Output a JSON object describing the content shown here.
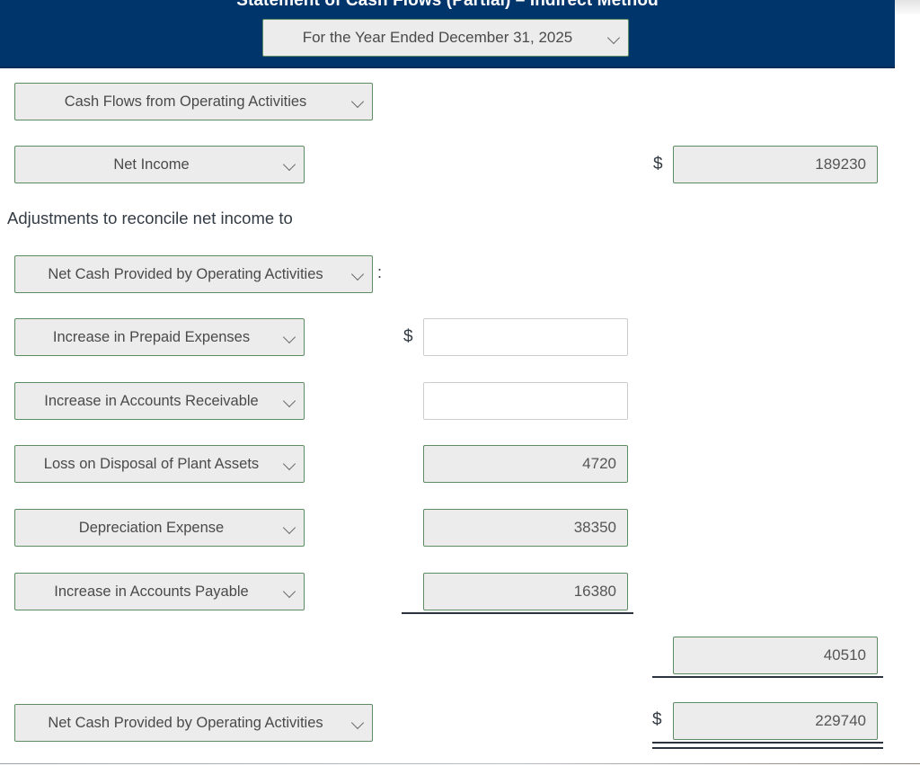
{
  "header": {
    "title": "Statement of Cash Flows (Partial) – Indirect Method",
    "period_select": {
      "value": "For the Year Ended December 31, 2025",
      "caret": "chevron-down-icon"
    },
    "background_color": "#00356b"
  },
  "colors": {
    "header_navy": "#00356b",
    "select_border_green": "#5e8c63",
    "select_fill_gray": "#ececec",
    "empty_input_border": "#cdcdcd",
    "rule_dark": "#2b3340",
    "text_dark": "#333b44"
  },
  "statement": {
    "section_select": {
      "value": "Cash Flows from Operating Activities"
    },
    "net_income_row": {
      "label_select": {
        "value": "Net Income"
      },
      "currency_symbol": "$",
      "amount": "189230"
    },
    "adjustments_text": "Adjustments to reconcile net income to",
    "subheading_select": {
      "value": "Net Cash Provided by Operating Activities"
    },
    "subheading_colon": ":",
    "first_adjustment_currency_symbol": "$",
    "adjustment_rows": [
      {
        "label_select": {
          "value": "Increase in Prepaid Expenses"
        },
        "amount": "",
        "filled": false
      },
      {
        "label_select": {
          "value": "Increase in Accounts Receivable"
        },
        "amount": "",
        "filled": false
      },
      {
        "label_select": {
          "value": "Loss on Disposal of Plant Assets"
        },
        "amount": "4720",
        "filled": true
      },
      {
        "label_select": {
          "value": "Depreciation Expense"
        },
        "amount": "38350",
        "filled": true
      },
      {
        "label_select": {
          "value": "Increase in Accounts Payable"
        },
        "amount": "16380",
        "filled": true
      }
    ],
    "adjustments_subtotal": {
      "amount": "40510"
    },
    "total_row": {
      "label_select": {
        "value": "Net Cash Provided by Operating Activities"
      },
      "currency_symbol": "$",
      "amount": "229740"
    }
  }
}
